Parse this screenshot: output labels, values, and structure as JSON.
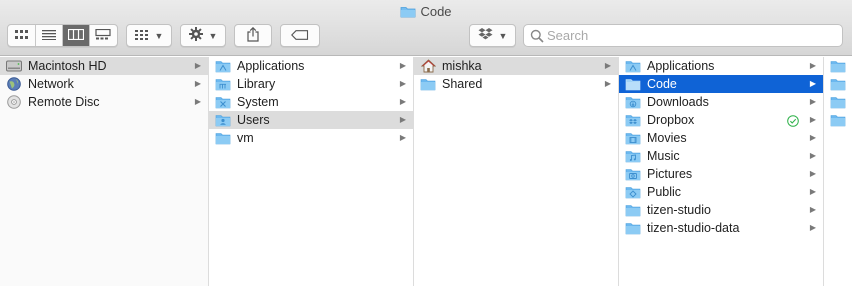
{
  "window": {
    "title": "Code"
  },
  "toolbar": {
    "view_buttons": [
      "icon-view",
      "list-view",
      "column-view",
      "gallery-view"
    ],
    "active_view": 2,
    "group_button": "group-icon",
    "action_button": "gear-icon",
    "share_button": "share-icon",
    "tag_button": "tag-icon",
    "dropbox_button": "dropbox-icon"
  },
  "search": {
    "placeholder": "Search"
  },
  "columns": [
    {
      "items": [
        {
          "label": "Macintosh HD",
          "icon": "harddisk",
          "selected": "gray",
          "arrow": true
        },
        {
          "label": "Network",
          "icon": "globe",
          "arrow": true
        },
        {
          "label": "Remote Disc",
          "icon": "disc",
          "arrow": true
        }
      ]
    },
    {
      "items": [
        {
          "label": "Applications",
          "icon": "folder-apps",
          "arrow": true
        },
        {
          "label": "Library",
          "icon": "folder-library",
          "arrow": true
        },
        {
          "label": "System",
          "icon": "folder-system",
          "arrow": true
        },
        {
          "label": "Users",
          "icon": "folder-users",
          "selected": "gray",
          "arrow": true
        },
        {
          "label": "vm",
          "icon": "folder",
          "arrow": true
        }
      ]
    },
    {
      "items": [
        {
          "label": "mishka",
          "icon": "home",
          "selected": "gray",
          "arrow": true
        },
        {
          "label": "Shared",
          "icon": "folder",
          "arrow": true
        }
      ]
    },
    {
      "items": [
        {
          "label": "Applications",
          "icon": "folder-apps",
          "arrow": true
        },
        {
          "label": "Code",
          "icon": "folder",
          "selected": "blue",
          "arrow": true
        },
        {
          "label": "Downloads",
          "icon": "folder-downloads",
          "arrow": true
        },
        {
          "label": "Dropbox",
          "icon": "folder-dropbox",
          "badge": "synced-check",
          "arrow": true
        },
        {
          "label": "Movies",
          "icon": "folder-movies",
          "arrow": true
        },
        {
          "label": "Music",
          "icon": "folder-music",
          "arrow": true
        },
        {
          "label": "Pictures",
          "icon": "folder-pictures",
          "arrow": true
        },
        {
          "label": "Public",
          "icon": "folder-public",
          "arrow": true
        },
        {
          "label": "tizen-studio",
          "icon": "folder",
          "arrow": true
        },
        {
          "label": "tizen-studio-data",
          "icon": "folder",
          "arrow": true
        }
      ]
    },
    {
      "items": [
        {
          "label": "",
          "icon": "folder"
        },
        {
          "label": "",
          "icon": "folder"
        },
        {
          "label": "",
          "icon": "folder"
        },
        {
          "label": "",
          "icon": "folder"
        }
      ]
    }
  ],
  "colors": {
    "selection_blue": "#0f63d6",
    "selection_gray": "#dcdcdc",
    "folder_blue": "#6cb8ef"
  }
}
